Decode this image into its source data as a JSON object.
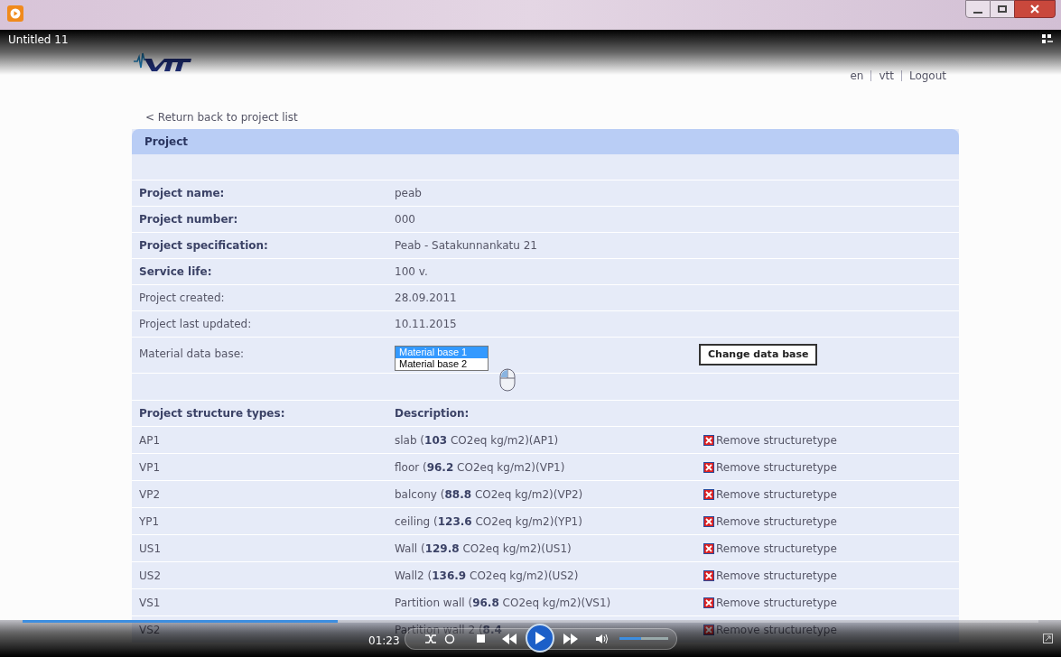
{
  "window": {
    "title": "Untitled 11"
  },
  "header": {
    "nav": [
      {
        "label": "en"
      },
      {
        "label": "vtt"
      },
      {
        "label": "Logout"
      }
    ]
  },
  "back_link": "< Return back to project list",
  "panel": {
    "title": "Project",
    "info_rows": [
      {
        "label": "Project name:",
        "value": "peab",
        "emphasized": true
      },
      {
        "label": "Project number:",
        "value": "000",
        "emphasized": true
      },
      {
        "label": "Project specification:",
        "value": "Peab - Satakunnankatu 21",
        "emphasized": true
      },
      {
        "label": "Service life:",
        "value": "100 v.",
        "emphasized": true
      },
      {
        "label": "Project created:",
        "value": "28.09.2011",
        "emphasized": false
      },
      {
        "label": "Project last updated:",
        "value": "10.11.2015",
        "emphasized": false
      }
    ],
    "material": {
      "label": "Material data base:",
      "options": [
        {
          "label": "Material base 1",
          "selected": true
        },
        {
          "label": "Material base 2",
          "selected": false
        }
      ],
      "button": "Change data base"
    },
    "structures": {
      "columns": [
        "Project structure types:",
        "Description:"
      ],
      "rows": [
        {
          "code": "AP1",
          "description": "slab (**103** CO2eq kg/m2)(AP1)",
          "action": "Remove structuretype"
        },
        {
          "code": "VP1",
          "description": "floor (**96.2** CO2eq kg/m2)(VP1)",
          "action": "Remove structuretype"
        },
        {
          "code": "VP2",
          "description": "balcony (**88.8** CO2eq kg/m2)(VP2)",
          "action": "Remove structuretype"
        },
        {
          "code": "YP1",
          "description": "ceiling (**123.6** CO2eq kg/m2)(YP1)",
          "action": "Remove structuretype"
        },
        {
          "code": "US1",
          "description": "Wall (**129.8** CO2eq kg/m2)(US1)",
          "action": "Remove structuretype"
        },
        {
          "code": "US2",
          "description": "Wall2 (**136.9** CO2eq kg/m2)(US2)",
          "action": "Remove structuretype"
        },
        {
          "code": "VS1",
          "description": "Partition wall (**96.8** CO2eq kg/m2)(VS1)",
          "action": "Remove structuretype"
        },
        {
          "code": "VS2",
          "description": "Partition wall 2 (**8.4**",
          "action": "Remove structuretype"
        }
      ]
    }
  },
  "player": {
    "time": "01:23",
    "progress": {
      "level": 0.31
    },
    "volume": {
      "level": 0.45
    }
  }
}
